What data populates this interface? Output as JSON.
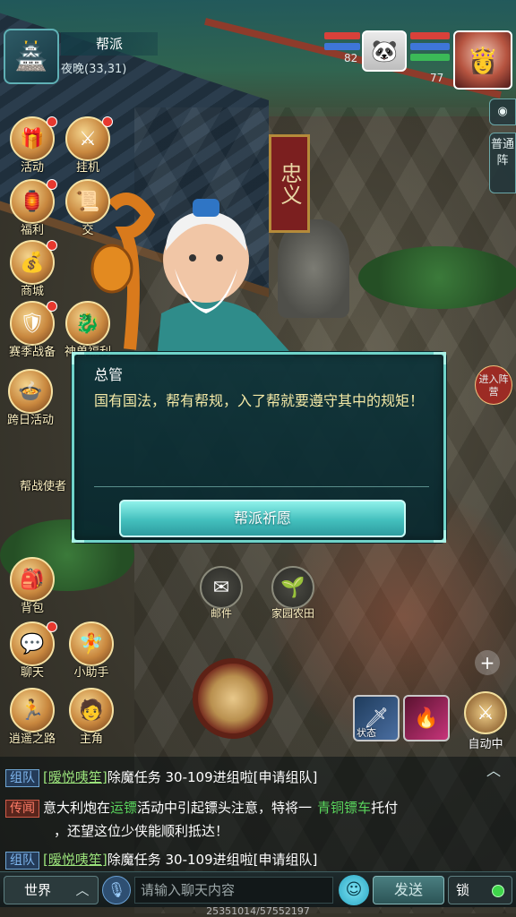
{
  "guild": {
    "name": "帮派",
    "time_coords": "夜晚(33,31)"
  },
  "status": {
    "pet_level": "82",
    "hero_level": "77"
  },
  "side_tabs": {
    "formation": "普通阵",
    "enter_battle": "进入阵营"
  },
  "left_menu": [
    {
      "label": "活动",
      "icon": "event-icon"
    },
    {
      "label": "挂机",
      "icon": "idle-icon"
    },
    {
      "label": "福利",
      "icon": "welfare-icon"
    },
    {
      "label": "交",
      "icon": "trade-icon"
    },
    {
      "label": "商城",
      "icon": "shop-icon"
    },
    {
      "label": "赛季战备",
      "icon": "season-icon"
    },
    {
      "label": "神兽福利",
      "icon": "beast-icon"
    },
    {
      "label": "跨日活动",
      "icon": "daily-icon"
    },
    {
      "label": "帮战使者",
      "icon": "guildwar-icon"
    }
  ],
  "bottom_left_menu": [
    {
      "label": "背包",
      "icon": "bag-icon"
    },
    {
      "label": "聊天",
      "icon": "chat-icon"
    },
    {
      "label": "小助手",
      "icon": "helper-icon"
    },
    {
      "label": "逍遥之路",
      "icon": "road-icon"
    },
    {
      "label": "主角",
      "icon": "hero-icon"
    }
  ],
  "mid_icons": [
    {
      "label": "邮件",
      "icon": "mail-icon"
    },
    {
      "label": "家园农田",
      "icon": "farm-icon"
    }
  ],
  "dialog": {
    "speaker": "总管",
    "text": "国有国法，帮有帮规，入了帮就要遵守其中的规矩！",
    "button": "帮派祈愿"
  },
  "skills": {
    "skill1_label": "状态",
    "auto_label": "自动中"
  },
  "chat": {
    "lines": [
      {
        "tag": "组队",
        "user": "[暧悦咦笙]",
        "text": "除魔任务 30-109进组啦[申请组队]"
      },
      {
        "tag": "传闻",
        "text_a": "意大利炮在",
        "link": "运镖",
        "text_b": "活动中引起镖头注意，特将一",
        "item": "青铜镖车",
        "text_c": "托付",
        "text_d": "，还望这位少侠能顺利抵达！"
      },
      {
        "tag": "组队",
        "user": "[暧悦咦笙]",
        "text": "除魔任务 30-109进组啦[申请组队]"
      }
    ]
  },
  "chat_bar": {
    "channel": "世界",
    "placeholder": "请输入聊天内容",
    "send": "发送",
    "lock": "锁"
  },
  "footer": "25351014/57552197"
}
